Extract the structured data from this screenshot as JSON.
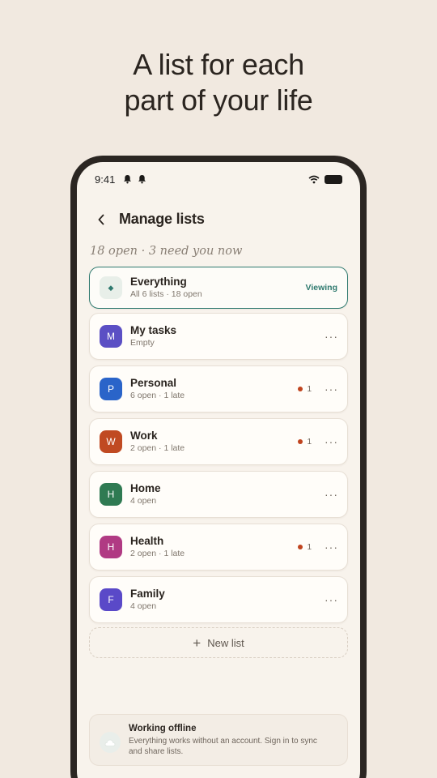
{
  "headline": {
    "line1": "A list for each",
    "line2": "part of your life"
  },
  "status_bar": {
    "time": "9:41",
    "icons": [
      "bell-icon",
      "bell-icon",
      "wifi-icon",
      "battery-icon"
    ]
  },
  "header": {
    "back_icon": "chevron-left-icon",
    "title": "Manage lists",
    "subtitle": "18 open · 3 need you now"
  },
  "colors": {
    "accent": "#2f7a6f",
    "late_dot": "#c0441f",
    "background": "#f1e9e0"
  },
  "lists": [
    {
      "initial": "◆",
      "name": "Everything",
      "meta": "All 6 lists · 18 open",
      "status": "Viewing",
      "color": "#e8efe9"
    },
    {
      "initial": "M",
      "name": "My tasks",
      "meta": "Empty",
      "late_count": "",
      "color": "#5b4fc4"
    },
    {
      "initial": "P",
      "name": "Personal",
      "meta": "6 open · 1 late",
      "late_count": "1",
      "color": "#2a64c9"
    },
    {
      "initial": "W",
      "name": "Work",
      "meta": "2 open · 1 late",
      "late_count": "1",
      "color": "#c04a22"
    },
    {
      "initial": "H",
      "name": "Home",
      "meta": "4 open",
      "late_count": "",
      "color": "#2f7a52"
    },
    {
      "initial": "H",
      "name": "Health",
      "meta": "2 open · 1 late",
      "late_count": "1",
      "color": "#b03a83"
    },
    {
      "initial": "F",
      "name": "Family",
      "meta": "4 open",
      "late_count": "",
      "color": "#5a49c8"
    }
  ],
  "new_list": {
    "label": "New list"
  },
  "offline_notice": {
    "title": "Working offline",
    "description": "Everything works without an account. Sign in to sync and share lists."
  }
}
